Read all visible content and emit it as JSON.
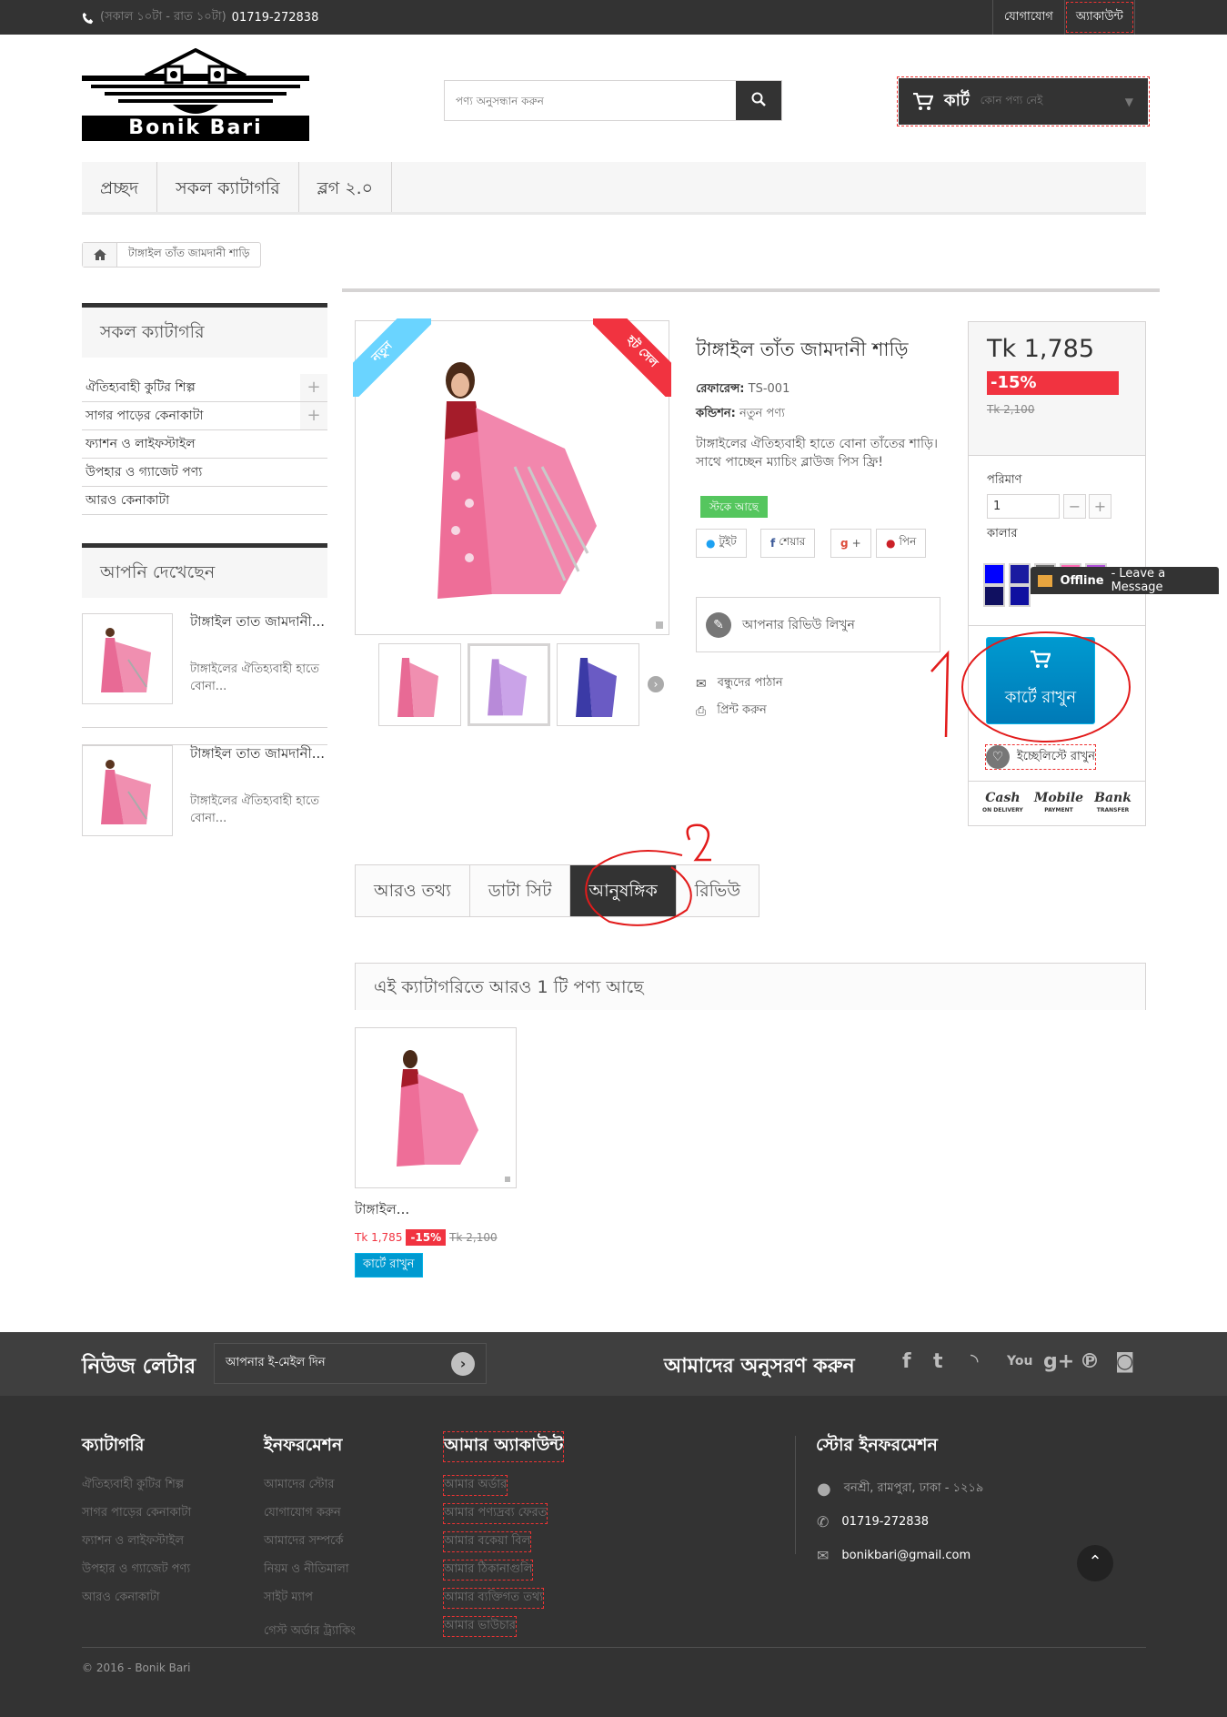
{
  "topbar": {
    "hours": "(সকাল ১০টা - রাত ১০টা)",
    "phone": "01719-272838",
    "contact": "যোগাযোগ",
    "account": "অ্যাকাউন্ট"
  },
  "header": {
    "logo_text": "Bonik Bari",
    "search_placeholder": "পণ্য অনুসন্ধান করুন",
    "cart_label": "কার্ট",
    "cart_empty": "কোন পণ্য নেই"
  },
  "menu": [
    "প্রচ্ছদ",
    "সকল ক্যাটাগরি",
    "ব্লগ ২.০"
  ],
  "breadcrumb": "টাঙ্গাইল তাঁত জামদানী শাড়ি",
  "sidebar": {
    "categories_title": "সকল ক্যাটাগরি",
    "categories": [
      "ঐতিহ্যবাহী কুটির শিল্প",
      "সাগর পাড়ের কেনাকাটা",
      "ফ্যাশন ও লাইফস্টাইল",
      "উপহার ও গ্যাজেট পণ্য",
      "আরও কেনাকাটা"
    ],
    "viewed_title": "আপনি দেখেছেন",
    "viewed": [
      {
        "name": "টাঙ্গাইল তাত জামদানী...",
        "desc": "টাঙ্গাইলের ঐতিহ্যবাহী হাতে বোনা..."
      },
      {
        "name": "টাঙ্গাইল তাত জামদানী...",
        "desc": "টাঙ্গাইলের ঐতিহ্যবাহী হাতে বোনা..."
      }
    ]
  },
  "product": {
    "title": "টাঙ্গাইল তাঁত জামদানী শাড়ি",
    "ribbon_new": "নতুন",
    "ribbon_sale": "হট সেল",
    "reference_label": "রেফারেন্স:",
    "reference": "TS-001",
    "condition_label": "কন্ডিশন:",
    "condition": "নতুন পণ্য",
    "description": "টাঙ্গাইলের ঐতিহ্যবাহী হাতে বোনা তাঁতের শাড়ি। সাথে পাচ্ছেন ম্যাচিং ব্লাউজ পিস ফ্রি!",
    "stock": "স্টকে আছে",
    "share": [
      "টুইট",
      "শেয়ার",
      "+",
      "পিন"
    ],
    "review": "আপনার রিভিউ লিখুন",
    "send_friend": "বন্ধুদের পাঠান",
    "print": "প্রিন্ট করুন",
    "price": "Tk 1,785",
    "discount": "-15%",
    "old_price": "Tk 2,100",
    "qty_label": "পরিমাণ",
    "qty": "1",
    "color_label": "কালার",
    "colors": [
      "#0000ff",
      "#1a1aa0",
      "#6b6b6b",
      "#ff69b4",
      "#b04fd9",
      "#101060",
      "#1010a0"
    ],
    "add_to_cart": "কার্টে রাখুন",
    "wishlist": "ইচ্ছেলিস্টে রাখুন",
    "payment": [
      {
        "name": "Cash",
        "sub": "ON DELIVERY"
      },
      {
        "name": "Mobile",
        "sub": "PAYMENT"
      },
      {
        "name": "Bank",
        "sub": "TRANSFER"
      }
    ]
  },
  "chat": {
    "status": "Offline",
    "text": "- Leave a Message"
  },
  "tabs": [
    "আরও তথ্য",
    "ডাটা সিট",
    "আনুষঙ্গিক",
    "রিভিউ"
  ],
  "accessories": {
    "title": "এই ক্যাটাগরিতে আরও 1 টি পণ্য আছে",
    "item": {
      "name": "টাঙ্গাইল...",
      "price": "Tk 1,785",
      "discount": "-15%",
      "old_price": "Tk 2,100",
      "button": "কার্টে রাখুন"
    }
  },
  "annotations": {
    "one": "1",
    "two": "2"
  },
  "newsletter": {
    "title": "নিউজ লেটার",
    "placeholder": "আপনার ই-মেইল দিন",
    "follow": "আমাদের অনুসরণ করুন"
  },
  "footer": {
    "cat_title": "ক্যাটাগরি",
    "cats": [
      "ঐতিহ্যবাহী কুটির শিল্প",
      "সাগর পাড়ের কেনাকাটা",
      "ফ্যাশন ও লাইফস্টাইল",
      "উপহার ও গ্যাজেট পণ্য",
      "আরও কেনাকাটা"
    ],
    "info_title": "ইনফরমেশন",
    "info": [
      "আমাদের স্টোর",
      "যোগাযোগ করুন",
      "আমাদের সম্পর্কে",
      "নিয়ম ও নীতিমালা",
      "সাইট ম্যাপ",
      "গেস্ট অর্ডার ট্র্যাকিং"
    ],
    "acc_title": "আমার অ্যাকাউন্ট",
    "acc": [
      "আমার অর্ডার",
      "আমার পণ্যদ্রব্য ফেরত",
      "আমার বকেয়া বিল",
      "আমার ঠিকানাগুলি",
      "আমার ব্যক্তিগত তথ্য",
      "আমার ভাউচার"
    ],
    "store_title": "স্টোর ইনফরমেশন",
    "address": "বনশ্রী, রামপুরা, ঢাকা - ১২১৯",
    "phone": "01719-272838",
    "email": "bonikbari@gmail.com",
    "copyright": "© 2016 - Bonik Bari"
  }
}
